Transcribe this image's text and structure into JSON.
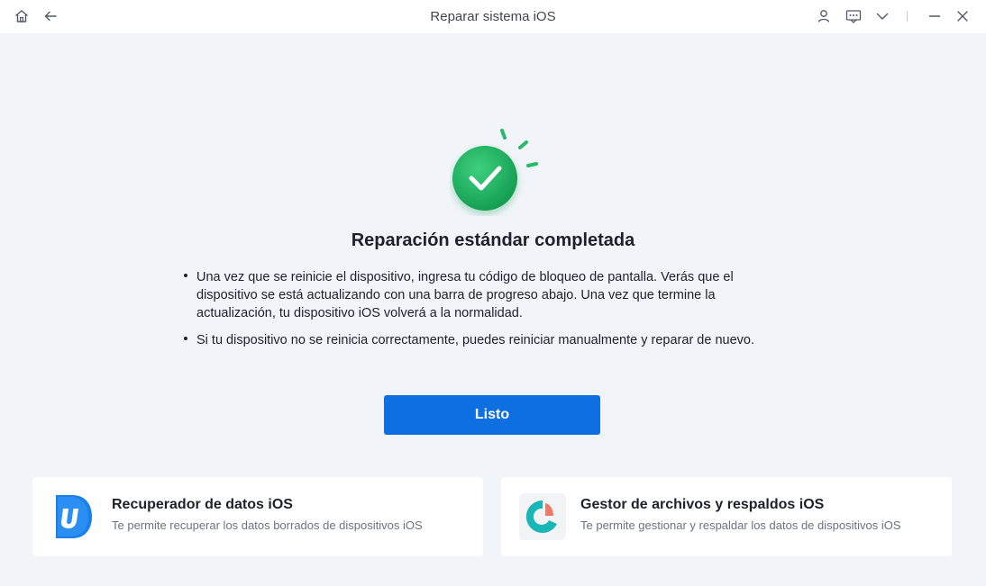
{
  "window": {
    "title": "Reparar sistema iOS",
    "icons": [
      "home-icon",
      "back-arrow-icon",
      "user-icon",
      "feedback-icon",
      "chevron-down-icon",
      "minimize-icon",
      "close-icon"
    ]
  },
  "result": {
    "heading": "Reparación estándar completada",
    "bullets": [
      "Una vez que se reinicie el dispositivo, ingresa tu código de bloqueo de pantalla. Verás que el dispositivo se está actualizando con una barra de progreso abajo. Una vez que termine la actualización, tu dispositivo iOS volverá a la normalidad.",
      "Si tu dispositivo no se reinicia correctamente, puedes reiniciar manualmente y reparar de nuevo."
    ],
    "done_label": "Listo"
  },
  "cards": [
    {
      "title": "Recuperador de datos iOS",
      "description": "Te permite recuperar los datos borrados de dispositivos iOS"
    },
    {
      "title": "Gestor de archivos y respaldos iOS",
      "description": "Te permite gestionar y respaldar los datos de dispositivos iOS"
    }
  ],
  "colors": {
    "accent": "#0d6fe0",
    "success": "#1aa35a",
    "background": "#f1f4f8"
  }
}
